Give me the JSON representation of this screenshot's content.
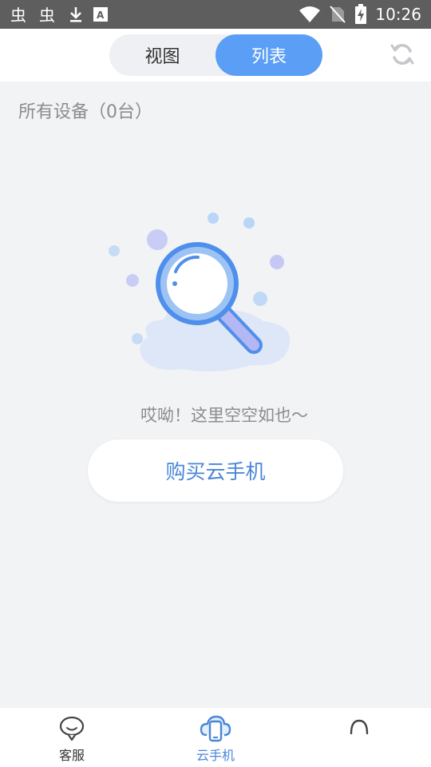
{
  "status_bar": {
    "time": "10:26",
    "icons": [
      "bug-icon",
      "bug-icon",
      "download-icon",
      "a-box-icon",
      "wifi-icon",
      "no-sim-icon",
      "battery-charging-icon"
    ]
  },
  "header": {
    "tabs": [
      {
        "label": "视图",
        "selected": false
      },
      {
        "label": "列表",
        "selected": true
      }
    ],
    "refresh_icon": "refresh-icon"
  },
  "main": {
    "device_count_label": "所有设备（0台）",
    "empty_illustration": "magnifier-empty-icon",
    "empty_text": "哎呦！这里空空如也～",
    "buy_button_label": "购买云手机"
  },
  "bottom_nav": {
    "items": [
      {
        "label": "客服",
        "icon": "chat-bubble-icon",
        "active": false
      },
      {
        "label": "云手机",
        "icon": "cloud-phone-icon",
        "active": true
      },
      {
        "label": "",
        "icon": "user-icon",
        "active": false
      }
    ]
  },
  "colors": {
    "accent": "#5a9ef5",
    "accent_text": "#4a86d8",
    "status_bar": "#5e5e5e",
    "background": "#f2f3f5"
  }
}
